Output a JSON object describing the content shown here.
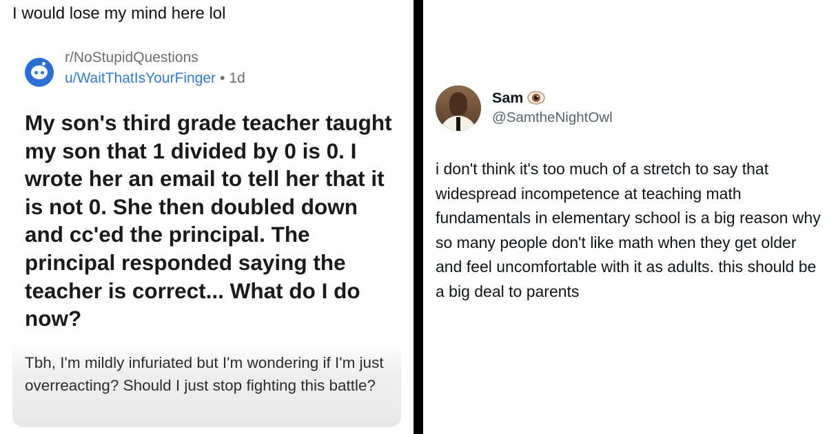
{
  "caption": "I would lose my mind here lol",
  "reddit_post": {
    "subreddit": "r/NoStupidQuestions",
    "username": "u/WaitThatIsYourFinger",
    "separator": "•",
    "age": "1d",
    "title": "My son's third grade teacher taught my son that 1 divided by 0 is 0. I wrote her an email to tell her that it is not 0. She then doubled down and cc'ed the principal. The principal responded saying the teacher is correct... What do I do now?",
    "body": "Tbh, I'm mildly infuriated but I'm wondering if I'm just overreacting? Should I just stop fighting this battle?",
    "colors": {
      "username": "#2f7ad6",
      "avatar": "#2a6fd6"
    }
  },
  "tweet": {
    "display_name": "Sam",
    "name_emoji": "eye-icon",
    "handle": "@SamtheNightOwl",
    "text": "i don't think it's too much of a stretch to say that widespread incompetence at teaching math fundamentals in elementary school is a big reason why so many people don't like math when they get older and feel uncomfortable with it as adults. this should be a big deal to parents",
    "colors": {
      "handle": "#536471"
    }
  }
}
